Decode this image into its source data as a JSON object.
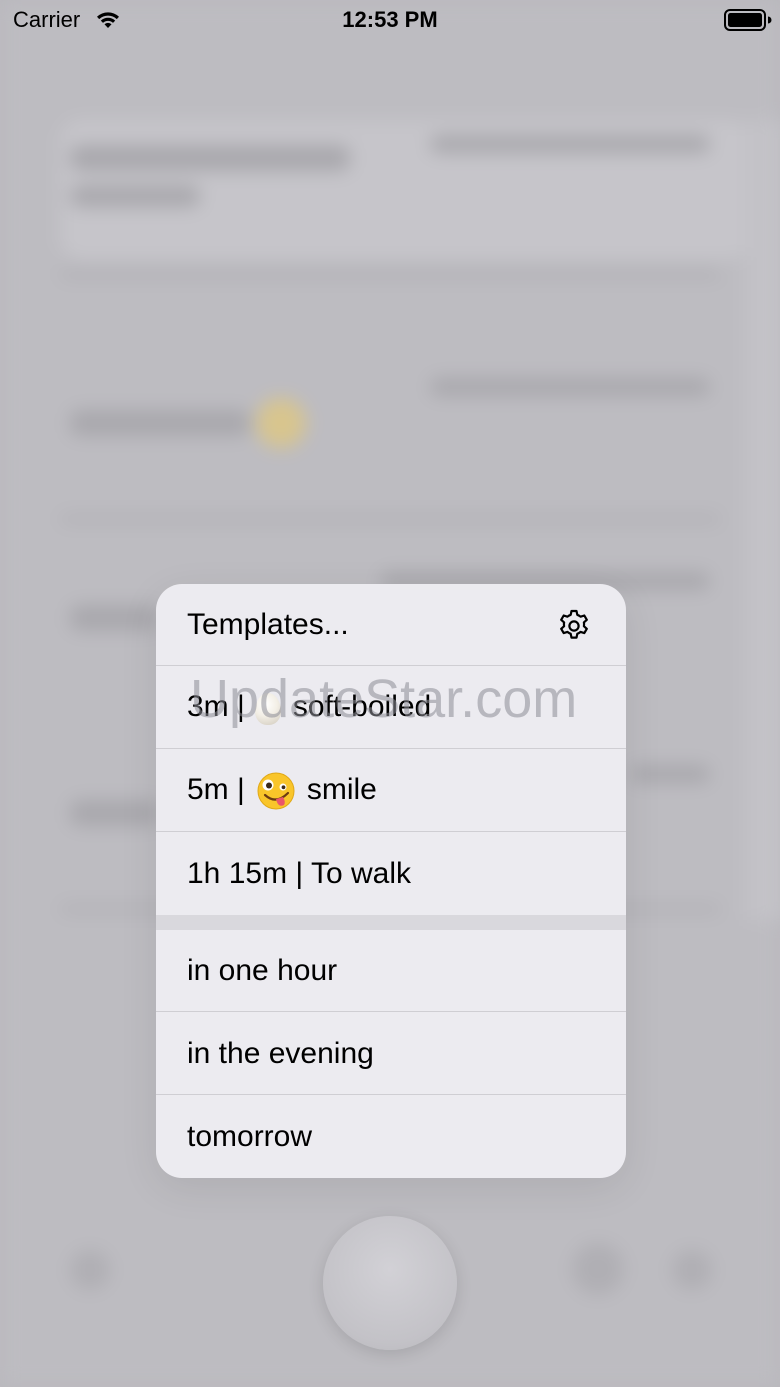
{
  "status_bar": {
    "carrier": "Carrier",
    "time": "12:53 PM"
  },
  "menu": {
    "header": {
      "label": "Templates...",
      "icon": "gear-icon"
    },
    "templates": [
      {
        "duration": "3m",
        "separator": "|",
        "emoji": "egg",
        "name": "soft-boiled"
      },
      {
        "duration": "5m",
        "separator": "|",
        "emoji": "zany-face",
        "name": "smile"
      },
      {
        "text": "1h 15m | To walk"
      }
    ],
    "presets": [
      {
        "label": "in one hour"
      },
      {
        "label": "in the evening"
      },
      {
        "label": "tomorrow"
      }
    ]
  },
  "watermark": "UpdateStar.com",
  "colors": {
    "menu_bg": "#ecebf0",
    "backdrop": "#b9b8bd",
    "separator": "#cfced3"
  }
}
